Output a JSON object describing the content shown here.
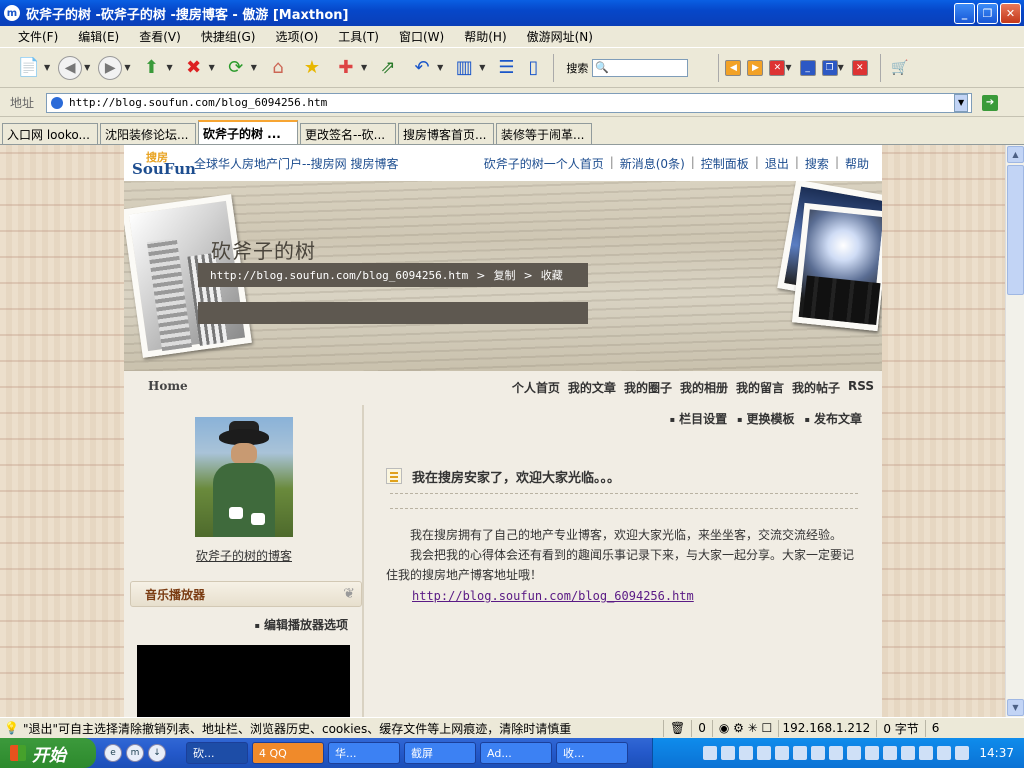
{
  "window": {
    "title": "砍斧子的树 -砍斧子的树 -搜房博客 - 傲游 [Maxthon]",
    "app_icon": "m"
  },
  "menu": [
    "文件(F)",
    "编辑(E)",
    "查看(V)",
    "快捷组(G)",
    "选项(O)",
    "工具(T)",
    "窗口(W)",
    "帮助(H)",
    "傲游网址(N)"
  ],
  "toolbar": {
    "search_label": "搜索",
    "search_value": ""
  },
  "address": {
    "label": "地址",
    "url": "http://blog.soufun.com/blog_6094256.htm"
  },
  "tabs": [
    {
      "label": "入口网 looko...",
      "active": false
    },
    {
      "label": "沈阳装修论坛...",
      "active": false
    },
    {
      "label": "砍斧子的树 ...",
      "active": true
    },
    {
      "label": "更改签名--砍...",
      "active": false
    },
    {
      "label": "搜房博客首页...",
      "active": false
    },
    {
      "label": "装修等于闹革...",
      "active": false
    }
  ],
  "site": {
    "logo_top": "搜房",
    "logo_bottom": "SouFun",
    "tagline": "全球华人房地产门户--搜房网 搜房博客",
    "top_links": [
      "砍斧子的树一个人首页",
      "新消息(0条)",
      "控制面板",
      "退出",
      "搜索",
      "帮助"
    ],
    "blog_title": "砍斧子的树",
    "blog_url": "http://blog.soufun.com/blog_6094256.htm",
    "copy": "复制",
    "favorite": "收藏",
    "gt": ">",
    "nav_home": "Home",
    "nav_links": [
      "个人首页",
      "我的文章",
      "我的圈子",
      "我的相册",
      "我的留言",
      "我的帖子",
      "RSS"
    ],
    "sub_nav": [
      "栏目设置",
      "更换模板",
      "发布文章"
    ],
    "avatar_caption": "砍斧子的树的博客",
    "music_title": "音乐播放器",
    "edit_player": "编辑播放器选项",
    "post_title": "我在搜房安家了，欢迎大家光临。。。",
    "post_p1": "我在搜房拥有了自己的地产专业博客，欢迎大家光临，来坐坐客，交流交流经验。",
    "post_p2": "我会把我的心得体会还有看到的趣闻乐事记录下来，与大家一起分享。大家一定要记住我的搜房地产博客地址哦！",
    "post_link": "http://blog.soufun.com/blog_6094256.htm"
  },
  "status": {
    "message": "\"退出\"可自主选择清除撤销列表、地址栏、浏览器历史、cookies、缓存文件等上网痕迹，清除时请慎重",
    "count0": "0",
    "ip": "192.168.1.212",
    "bytes": "0 字节",
    "extra": "6"
  },
  "taskbar": {
    "start": "开始",
    "tasks": [
      {
        "label": "砍...",
        "type": "normal"
      },
      {
        "label": "4 QQ",
        "type": "qq"
      },
      {
        "label": "华...",
        "type": "normal"
      },
      {
        "label": "截屏",
        "type": "normal"
      },
      {
        "label": "Ad...",
        "type": "normal"
      },
      {
        "label": "收...",
        "type": "normal"
      }
    ],
    "clock": "14:37"
  }
}
